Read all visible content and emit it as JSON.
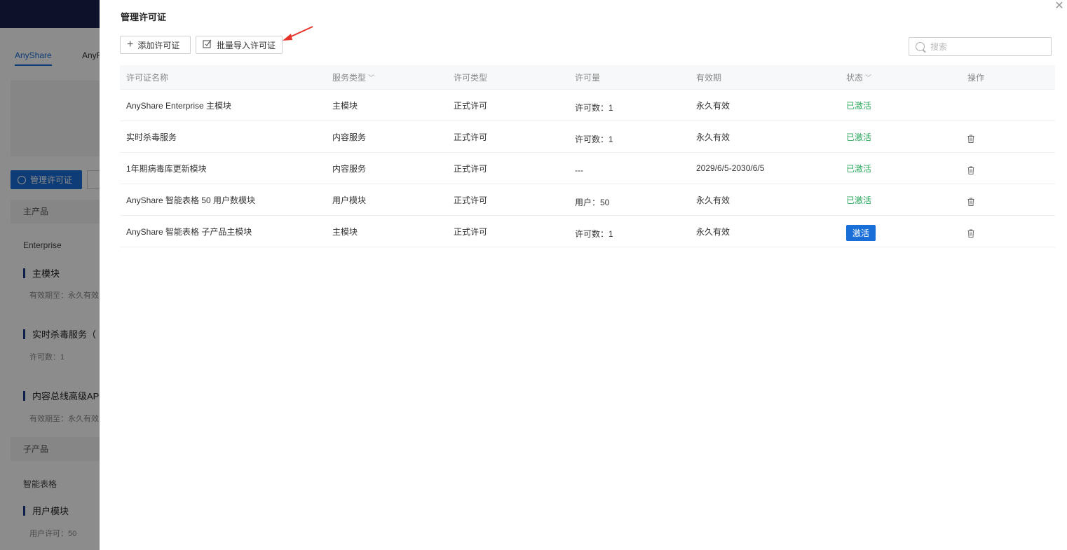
{
  "background": {
    "tabs": [
      "AnyShare",
      "AnyF"
    ],
    "manage_button": "管理许可证",
    "main_product_header": "主产品",
    "main_product_name": "Enterprise",
    "modules": [
      {
        "title": "主模块",
        "sub": "有效期至：永久有效"
      },
      {
        "title": "实时杀毒服务（",
        "sub": "许可数：1"
      },
      {
        "title": "内容总线高级AP",
        "sub": "有效期至：永久有效"
      }
    ],
    "sub_product_header": "子产品",
    "sub_product_name": "智能表格",
    "sub_modules": [
      {
        "title": "用户模块",
        "sub": "用户许可：50"
      }
    ]
  },
  "drawer": {
    "title": "管理许可证",
    "add_button": "添加许可证",
    "import_button": "批量导入许可证",
    "search_placeholder": "搜索"
  },
  "table": {
    "headers": [
      "许可证名称",
      "服务类型",
      "许可类型",
      "许可量",
      "有效期",
      "状态",
      "操作"
    ],
    "rows": [
      {
        "name": "AnyShare Enterprise 主模块",
        "service": "主模块",
        "type": "正式许可",
        "amount": "许可数：1",
        "validity": "永久有效",
        "status": "已激活",
        "status_kind": "active",
        "deletable": false
      },
      {
        "name": "实时杀毒服务",
        "service": "内容服务",
        "type": "正式许可",
        "amount": "许可数：1",
        "validity": "永久有效",
        "status": "已激活",
        "status_kind": "active",
        "deletable": true
      },
      {
        "name": "1年期病毒库更新模块",
        "service": "内容服务",
        "type": "正式许可",
        "amount": "---",
        "validity": "2029/6/5-2030/6/5",
        "status": "已激活",
        "status_kind": "active",
        "deletable": true
      },
      {
        "name": "AnyShare 智能表格 50 用户数模块",
        "service": "用户模块",
        "type": "正式许可",
        "amount": "用户：50",
        "validity": "永久有效",
        "status": "已激活",
        "status_kind": "active",
        "deletable": true
      },
      {
        "name": "AnyShare 智能表格 子产品主模块",
        "service": "主模块",
        "type": "正式许可",
        "amount": "许可数：1",
        "validity": "永久有效",
        "status": "激活",
        "status_kind": "button",
        "deletable": true
      }
    ]
  },
  "colors": {
    "primary": "#1a6ed8",
    "active_status": "#2aa85c",
    "annotation_arrow": "#e8332a"
  }
}
